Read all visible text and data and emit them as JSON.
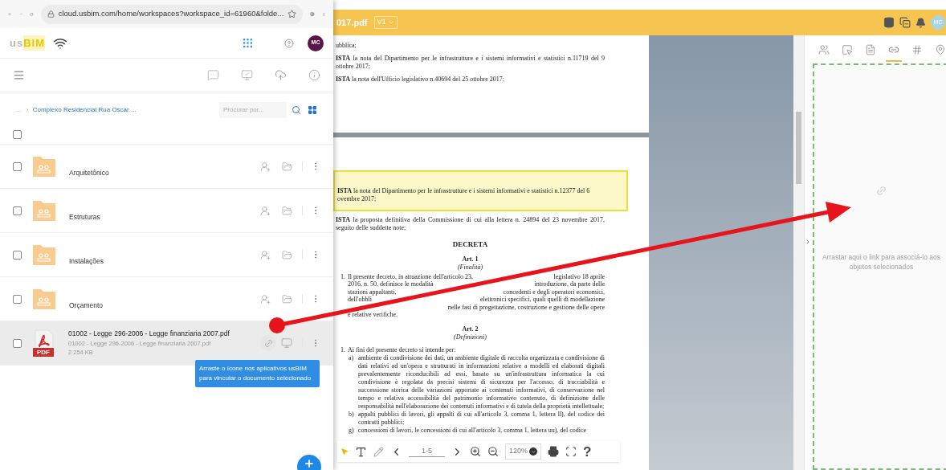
{
  "browser": {
    "url": "cloud.usbim.com/home/workspaces?workspace_id=61960&folde..."
  },
  "app_header": {
    "logo": [
      "us",
      "BIM"
    ],
    "avatar": "MC"
  },
  "breadcrumb": {
    "ellipsis": "...",
    "current": "Complexo Residencial Rua Oscar ...",
    "search": {
      "placeholder": "Procurar por..."
    }
  },
  "select_all": {
    "checked": false
  },
  "items": [
    {
      "kind": "folder",
      "name": "Arquitetônico",
      "checked": false,
      "hovered": false
    },
    {
      "kind": "folder",
      "name": "Estruturas",
      "checked": false,
      "hovered": false
    },
    {
      "kind": "folder",
      "name": "Instalações",
      "checked": false,
      "hovered": false
    },
    {
      "kind": "folder",
      "name": "Orçamento",
      "checked": false,
      "hovered": false
    },
    {
      "kind": "file",
      "name": "01002 - Legge 296-2006 - Legge finanziaria 2007.pdf",
      "subtitle": "01002 - Legge 296-2006 - Legge finanziaria 2007.pdf",
      "size": "2 254 KB",
      "badge": "PDF",
      "checked": false,
      "hovered": true
    }
  ],
  "tooltip": "Arraste o ícone nos aplicativos usBIM para vincular o documento selecionado",
  "viewer": {
    "title": "017.pdf",
    "version": "V1",
    "avatar": "MC"
  },
  "document": {
    "page_1": [
      {
        "kind": "text",
        "text": "ubblica;"
      },
      {
        "kind": "text",
        "text": "**ISTA** la nota del Dipartimento per le infrastrutture e i sistemi informativi e statistici n.11719 del 9 ottobre 2017;"
      },
      {
        "kind": "text",
        "text": "**ISTA** la nota dell'Ufficio legislativo n.40694 del 25 ottobre 2017;"
      }
    ],
    "page_2": [
      {
        "kind": "highlight",
        "text": "**ISTA** la nota del Dipartimento per le infrastrutture e i sistemi informativi e statistici n.12377 del 6 ovembre 2017;"
      },
      {
        "kind": "text",
        "text": "**ISTA** la proposta definitiva della Commissione di cui alla lettera n. 24894 del 23 novembre 2017, seguito delle suddette note;"
      },
      {
        "kind": "title",
        "text": "DECRETA"
      },
      {
        "kind": "article",
        "text": "Art. 1"
      },
      {
        "kind": "subtitle",
        "text": "(Finalità)"
      },
      {
        "kind": "covered",
        "marker": "1.",
        "lines": [
          {
            "left": "Il presente decreto, in attuazione dell'articolo 23,",
            "right": "legislativo 18 aprile"
          },
          {
            "left": "2016, n. 50, definisce le modalità",
            "right": "introduzione, da parte delle"
          },
          {
            "left": "stazioni appaltanti,",
            "right": "concedenti e degli operatori economici,"
          },
          {
            "left": "dell'obbli",
            "right": "elettronici specifici, quali quelli di modellazione"
          },
          {
            "right": "nelle fasi di progettazione, costruzione e gestione delle opere"
          },
          {
            "left": "e relative verifiche."
          }
        ]
      },
      {
        "kind": "article",
        "text": "Art. 2"
      },
      {
        "kind": "subtitle",
        "text": "(Definizioni)"
      },
      {
        "kind": "numbered",
        "marker": "1.",
        "text": "Ai fini del presente decreto si intende per:"
      },
      {
        "kind": "lettered",
        "marker": "a)",
        "text": "ambiente di condivisione dei dati, un ambiente digitale di raccolta organizzata e condivisione di dati relativi ad un'opera e strutturati in informazioni relative a modelli ed elaborati digitali prevalentemente riconducibili ad essi, basato su un'infrastruttura informatica la cui condivisione è regolata da precisi sistemi di sicurezza per l'accesso, di tracciabilità e successione storica delle variazioni apportate ai contenuti informativi, di conservazione nel tempo e relativa accessibilità del patrimonio informativo contenuto, di definizione delle responsabilità nell'elaborazione dei contenuti informativi e di tutela della proprietà intellettuale;"
      },
      {
        "kind": "lettered",
        "marker": "b)",
        "text": "appalti pubblici di lavori, gli appalti di cui all'articolo 3, comma 1, lettera ll), del codice dei contratti pubblici;"
      },
      {
        "kind": "lettered",
        "marker": "g)",
        "text": "concessioni di lavori, le concessioni di cui all'articolo 3, comma 1, lettera uu), del codice"
      }
    ]
  },
  "viewer_toolbar": {
    "page": "1-5",
    "zoom": "120%",
    "help": "?"
  },
  "sidebar": {
    "tabs": [
      {
        "kind": "users",
        "selected": false
      },
      {
        "kind": "select",
        "selected": false
      },
      {
        "kind": "file",
        "selected": false
      },
      {
        "kind": "link",
        "selected": true
      },
      {
        "kind": "hash",
        "selected": false
      },
      {
        "kind": "pin",
        "selected": false
      }
    ],
    "drop_zone": "Arrastar aqui o link para associá-lo aos objetos selecionados"
  }
}
